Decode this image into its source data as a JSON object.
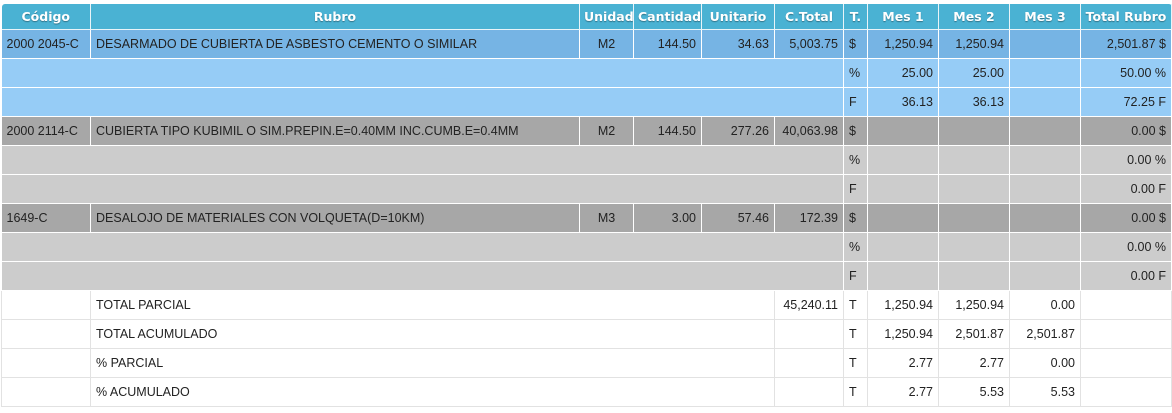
{
  "columns": [
    "Código",
    "Rubro",
    "Unidad",
    "Cantidad",
    "Unitario",
    "C.Total",
    "T.",
    "Mes 1",
    "Mes 2",
    "Mes 3",
    "Total Rubro"
  ],
  "items": [
    {
      "code": "2000 2045-C",
      "rubro": "DESARMADO DE CUBIERTA DE ASBESTO CEMENTO O SIMILAR",
      "unidad": "M2",
      "cantidad": "144.50",
      "unitario": "34.63",
      "ctotal": "5,003.75",
      "t": "$",
      "mes1": "1,250.94",
      "mes2": "1,250.94",
      "mes3": "",
      "total": "2,501.87 $",
      "pct": {
        "t": "%",
        "mes1": "25.00",
        "mes2": "25.00",
        "mes3": "",
        "total": "50.00 %"
      },
      "f": {
        "t": "F",
        "mes1": "36.13",
        "mes2": "36.13",
        "mes3": "",
        "total": "72.25 F"
      }
    },
    {
      "code": "2000 2114-C",
      "rubro": "CUBIERTA TIPO KUBIMIL O SIM.PREPIN.E=0.40MM INC.CUMB.E=0.4MM",
      "unidad": "M2",
      "cantidad": "144.50",
      "unitario": "277.26",
      "ctotal": "40,063.98",
      "t": "$",
      "mes1": "",
      "mes2": "",
      "mes3": "",
      "total": "0.00 $",
      "pct": {
        "t": "%",
        "mes1": "",
        "mes2": "",
        "mes3": "",
        "total": "0.00 %"
      },
      "f": {
        "t": "F",
        "mes1": "",
        "mes2": "",
        "mes3": "",
        "total": "0.00 F"
      }
    },
    {
      "code": "1649-C",
      "rubro": "DESALOJO DE MATERIALES CON VOLQUETA(D=10KM)",
      "unidad": "M3",
      "cantidad": "3.00",
      "unitario": "57.46",
      "ctotal": "172.39",
      "t": "$",
      "mes1": "",
      "mes2": "",
      "mes3": "",
      "total": "0.00 $",
      "pct": {
        "t": "%",
        "mes1": "",
        "mes2": "",
        "mes3": "",
        "total": "0.00 %"
      },
      "f": {
        "t": "F",
        "mes1": "",
        "mes2": "",
        "mes3": "",
        "total": "0.00 F"
      }
    }
  ],
  "totals": [
    {
      "label": "TOTAL PARCIAL",
      "ctotal": "45,240.11",
      "t": "T",
      "mes1": "1,250.94",
      "mes2": "1,250.94",
      "mes3": "0.00"
    },
    {
      "label": "TOTAL ACUMULADO",
      "ctotal": "",
      "t": "T",
      "mes1": "1,250.94",
      "mes2": "2,501.87",
      "mes3": "2,501.87"
    },
    {
      "label": "% PARCIAL",
      "ctotal": "",
      "t": "T",
      "mes1": "2.77",
      "mes2": "2.77",
      "mes3": "0.00"
    },
    {
      "label": "% ACUMULADO",
      "ctotal": "",
      "t": "T",
      "mes1": "2.77",
      "mes2": "5.53",
      "mes3": "5.53"
    }
  ],
  "colors": {
    "header": "#4ab2d3",
    "selected_item": "#76b4e4",
    "selected_sub": "#96ccf6",
    "item": "#a7a7a7",
    "sub": "#cccccc"
  }
}
